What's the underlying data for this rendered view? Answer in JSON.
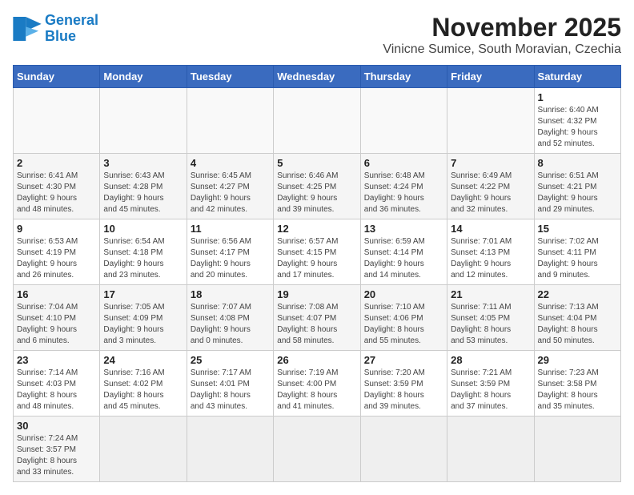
{
  "logo": {
    "line1": "General",
    "line2": "Blue"
  },
  "title": "November 2025",
  "location": "Vinicne Sumice, South Moravian, Czechia",
  "days_of_week": [
    "Sunday",
    "Monday",
    "Tuesday",
    "Wednesday",
    "Thursday",
    "Friday",
    "Saturday"
  ],
  "weeks": [
    [
      {
        "day": "",
        "info": ""
      },
      {
        "day": "",
        "info": ""
      },
      {
        "day": "",
        "info": ""
      },
      {
        "day": "",
        "info": ""
      },
      {
        "day": "",
        "info": ""
      },
      {
        "day": "",
        "info": ""
      },
      {
        "day": "1",
        "info": "Sunrise: 6:40 AM\nSunset: 4:32 PM\nDaylight: 9 hours\nand 52 minutes."
      }
    ],
    [
      {
        "day": "2",
        "info": "Sunrise: 6:41 AM\nSunset: 4:30 PM\nDaylight: 9 hours\nand 48 minutes."
      },
      {
        "day": "3",
        "info": "Sunrise: 6:43 AM\nSunset: 4:28 PM\nDaylight: 9 hours\nand 45 minutes."
      },
      {
        "day": "4",
        "info": "Sunrise: 6:45 AM\nSunset: 4:27 PM\nDaylight: 9 hours\nand 42 minutes."
      },
      {
        "day": "5",
        "info": "Sunrise: 6:46 AM\nSunset: 4:25 PM\nDaylight: 9 hours\nand 39 minutes."
      },
      {
        "day": "6",
        "info": "Sunrise: 6:48 AM\nSunset: 4:24 PM\nDaylight: 9 hours\nand 36 minutes."
      },
      {
        "day": "7",
        "info": "Sunrise: 6:49 AM\nSunset: 4:22 PM\nDaylight: 9 hours\nand 32 minutes."
      },
      {
        "day": "8",
        "info": "Sunrise: 6:51 AM\nSunset: 4:21 PM\nDaylight: 9 hours\nand 29 minutes."
      }
    ],
    [
      {
        "day": "9",
        "info": "Sunrise: 6:53 AM\nSunset: 4:19 PM\nDaylight: 9 hours\nand 26 minutes."
      },
      {
        "day": "10",
        "info": "Sunrise: 6:54 AM\nSunset: 4:18 PM\nDaylight: 9 hours\nand 23 minutes."
      },
      {
        "day": "11",
        "info": "Sunrise: 6:56 AM\nSunset: 4:17 PM\nDaylight: 9 hours\nand 20 minutes."
      },
      {
        "day": "12",
        "info": "Sunrise: 6:57 AM\nSunset: 4:15 PM\nDaylight: 9 hours\nand 17 minutes."
      },
      {
        "day": "13",
        "info": "Sunrise: 6:59 AM\nSunset: 4:14 PM\nDaylight: 9 hours\nand 14 minutes."
      },
      {
        "day": "14",
        "info": "Sunrise: 7:01 AM\nSunset: 4:13 PM\nDaylight: 9 hours\nand 12 minutes."
      },
      {
        "day": "15",
        "info": "Sunrise: 7:02 AM\nSunset: 4:11 PM\nDaylight: 9 hours\nand 9 minutes."
      }
    ],
    [
      {
        "day": "16",
        "info": "Sunrise: 7:04 AM\nSunset: 4:10 PM\nDaylight: 9 hours\nand 6 minutes."
      },
      {
        "day": "17",
        "info": "Sunrise: 7:05 AM\nSunset: 4:09 PM\nDaylight: 9 hours\nand 3 minutes."
      },
      {
        "day": "18",
        "info": "Sunrise: 7:07 AM\nSunset: 4:08 PM\nDaylight: 9 hours\nand 0 minutes."
      },
      {
        "day": "19",
        "info": "Sunrise: 7:08 AM\nSunset: 4:07 PM\nDaylight: 8 hours\nand 58 minutes."
      },
      {
        "day": "20",
        "info": "Sunrise: 7:10 AM\nSunset: 4:06 PM\nDaylight: 8 hours\nand 55 minutes."
      },
      {
        "day": "21",
        "info": "Sunrise: 7:11 AM\nSunset: 4:05 PM\nDaylight: 8 hours\nand 53 minutes."
      },
      {
        "day": "22",
        "info": "Sunrise: 7:13 AM\nSunset: 4:04 PM\nDaylight: 8 hours\nand 50 minutes."
      }
    ],
    [
      {
        "day": "23",
        "info": "Sunrise: 7:14 AM\nSunset: 4:03 PM\nDaylight: 8 hours\nand 48 minutes."
      },
      {
        "day": "24",
        "info": "Sunrise: 7:16 AM\nSunset: 4:02 PM\nDaylight: 8 hours\nand 45 minutes."
      },
      {
        "day": "25",
        "info": "Sunrise: 7:17 AM\nSunset: 4:01 PM\nDaylight: 8 hours\nand 43 minutes."
      },
      {
        "day": "26",
        "info": "Sunrise: 7:19 AM\nSunset: 4:00 PM\nDaylight: 8 hours\nand 41 minutes."
      },
      {
        "day": "27",
        "info": "Sunrise: 7:20 AM\nSunset: 3:59 PM\nDaylight: 8 hours\nand 39 minutes."
      },
      {
        "day": "28",
        "info": "Sunrise: 7:21 AM\nSunset: 3:59 PM\nDaylight: 8 hours\nand 37 minutes."
      },
      {
        "day": "29",
        "info": "Sunrise: 7:23 AM\nSunset: 3:58 PM\nDaylight: 8 hours\nand 35 minutes."
      }
    ],
    [
      {
        "day": "30",
        "info": "Sunrise: 7:24 AM\nSunset: 3:57 PM\nDaylight: 8 hours\nand 33 minutes."
      },
      {
        "day": "",
        "info": ""
      },
      {
        "day": "",
        "info": ""
      },
      {
        "day": "",
        "info": ""
      },
      {
        "day": "",
        "info": ""
      },
      {
        "day": "",
        "info": ""
      },
      {
        "day": "",
        "info": ""
      }
    ]
  ]
}
